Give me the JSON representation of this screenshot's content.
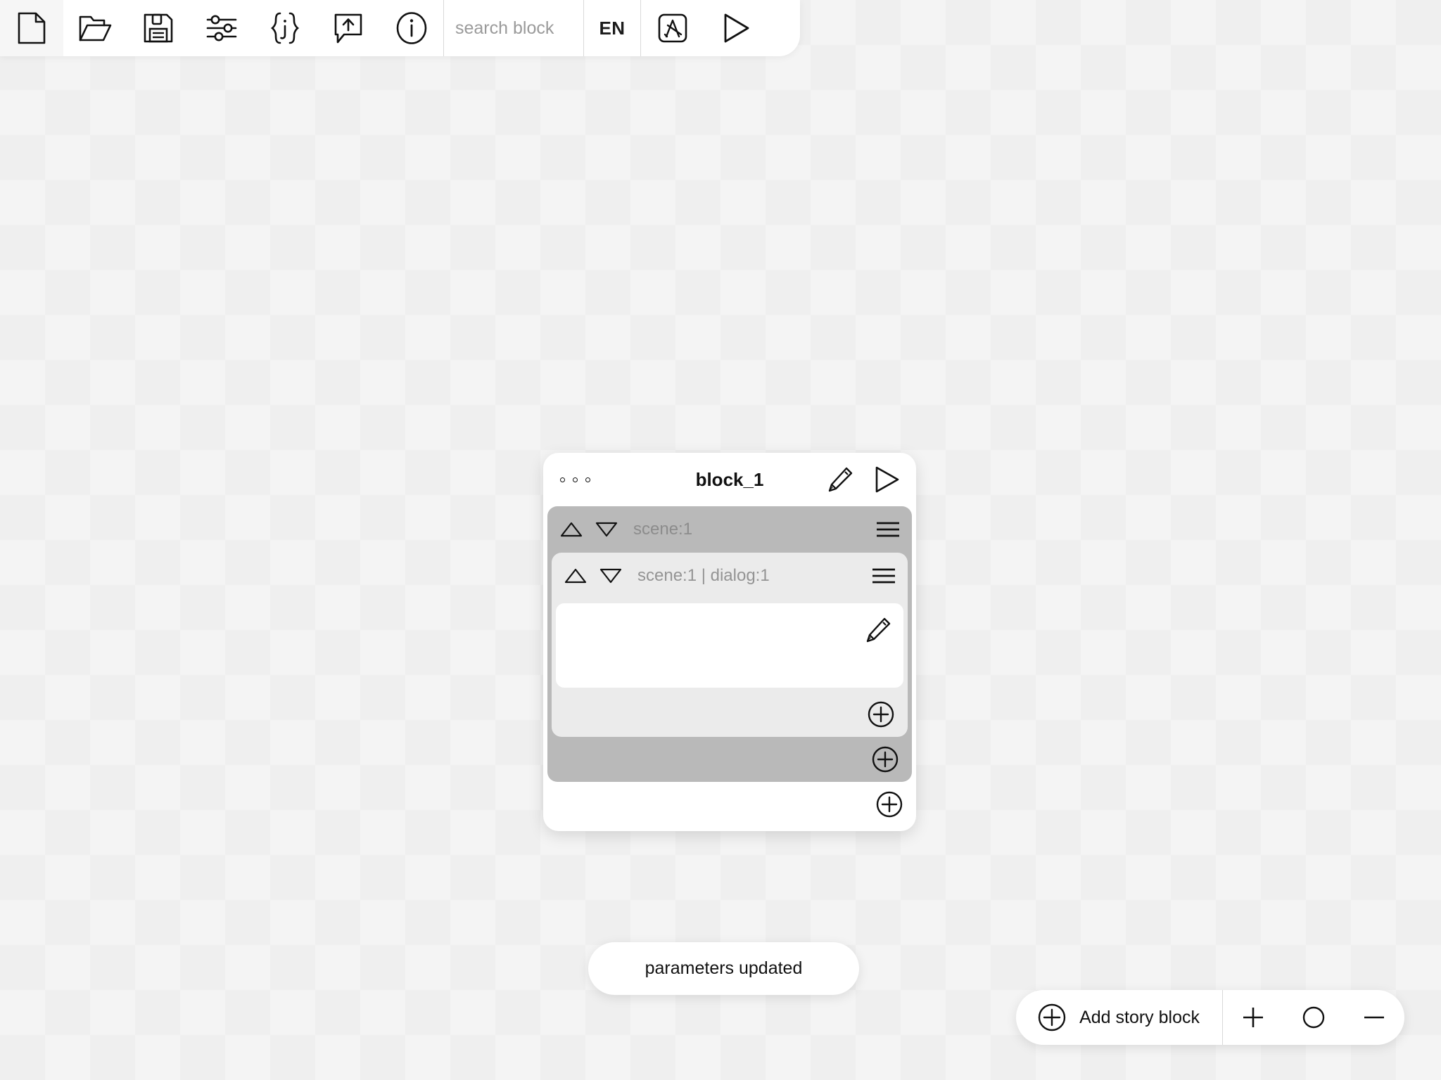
{
  "toolbar": {
    "buttons": [
      {
        "name": "new-file",
        "icon": "document-icon",
        "label": "New"
      },
      {
        "name": "open-file",
        "icon": "folder-open-icon",
        "label": "Open"
      },
      {
        "name": "save-file",
        "icon": "floppy-disk-icon",
        "label": "Save"
      },
      {
        "name": "settings",
        "icon": "sliders-icon",
        "label": "Settings"
      },
      {
        "name": "json-view",
        "icon": "json-braces-icon",
        "label": "JSON"
      },
      {
        "name": "export",
        "icon": "export-bubble-icon",
        "label": "Export"
      },
      {
        "name": "info",
        "icon": "info-circle-icon",
        "label": "Info"
      }
    ],
    "search": {
      "placeholder": "search block",
      "value": ""
    },
    "language": "EN",
    "localize_icon": "translate-box-icon",
    "localize_label": "Localization",
    "run_icon": "play-triangle-icon",
    "run_label": "Run"
  },
  "block": {
    "title": "block_1",
    "menu_icon": "three-dots-icon",
    "edit_icon": "pencil-icon",
    "run_icon": "play-triangle-icon",
    "scene": {
      "label": "scene:1",
      "up_icon": "triangle-up-icon",
      "down_icon": "triangle-down-icon",
      "menu_icon": "hamburger-icon",
      "add_icon": "plus-circle-icon",
      "dialog": {
        "label": "scene:1 | dialog:1",
        "up_icon": "triangle-up-icon",
        "down_icon": "triangle-down-icon",
        "menu_icon": "hamburger-icon",
        "add_icon": "plus-circle-icon",
        "text_value": "",
        "text_edit_icon": "pencil-icon"
      }
    },
    "add_icon": "plus-circle-icon"
  },
  "toast": {
    "message": "parameters updated"
  },
  "bottom_bar": {
    "add_story_icon": "plus-circle-icon",
    "add_story_label": "Add story block",
    "zoom_in_icon": "plus-icon",
    "zoom_reset_icon": "circle-icon",
    "zoom_out_icon": "minus-icon"
  },
  "colors": {
    "scene_container": "#b9b9b9",
    "dialog_container": "#ebebeb",
    "card": "#ffffff",
    "label_text": "#8e8e8e",
    "canvas": "#f4f4f4"
  }
}
